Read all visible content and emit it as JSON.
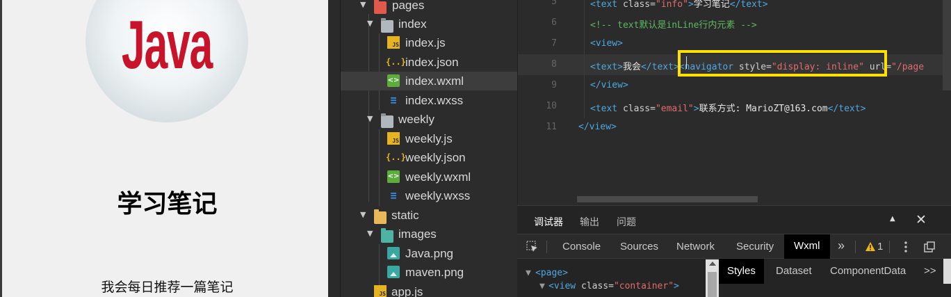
{
  "simulator": {
    "logo_text": "Java",
    "title": "学习笔记",
    "intro": "我会每日推荐一篇笔记"
  },
  "file_tree": {
    "items": [
      {
        "label": "pages",
        "kind": "folder-pages"
      },
      {
        "label": "index",
        "kind": "folder"
      },
      {
        "label": "index.js",
        "kind": "js"
      },
      {
        "label": "index.json",
        "kind": "json"
      },
      {
        "label": "index.wxml",
        "kind": "wxml",
        "selected": true
      },
      {
        "label": "index.wxss",
        "kind": "wxss"
      },
      {
        "label": "weekly",
        "kind": "folder"
      },
      {
        "label": "weekly.js",
        "kind": "js"
      },
      {
        "label": "weekly.json",
        "kind": "json"
      },
      {
        "label": "weekly.wxml",
        "kind": "wxml"
      },
      {
        "label": "weekly.wxss",
        "kind": "wxss"
      },
      {
        "label": "static",
        "kind": "folder-static"
      },
      {
        "label": "images",
        "kind": "folder-images"
      },
      {
        "label": "Java.png",
        "kind": "png"
      },
      {
        "label": "maven.png",
        "kind": "png"
      },
      {
        "label": "app.js",
        "kind": "js"
      }
    ]
  },
  "editor": {
    "line_numbers": [
      "5",
      "6",
      "7",
      "8",
      "9",
      "10",
      "11"
    ],
    "line5": {
      "open": "<text ",
      "attr": "class=",
      "value": "\"info\"",
      "close": ">",
      "text": "学习笔记",
      "end": "</text>"
    },
    "line6": "<!-- text默认是inLine行内元素 -->",
    "line7": "<view>",
    "line8": {
      "open": "<text>",
      "text": "我会",
      "close": "</text>",
      "nav": "<navigator",
      "attr": " style=",
      "value": "\"display: inline\"",
      "attr2": " url=",
      "value2": "\"/page"
    },
    "line9": "</view>",
    "line10": {
      "open": "<text ",
      "attr": "class=",
      "value": "\"email\"",
      "close": ">",
      "text": "联系方式: MarioZT@163.com",
      "end": "</text>"
    },
    "line11": "</view>"
  },
  "debugger": {
    "tabs": [
      "调试器",
      "输出",
      "问题"
    ],
    "devtools_tabs": [
      "Console",
      "Sources",
      "Network",
      "Security",
      "Wxml"
    ],
    "more": "»",
    "warning_count": "1",
    "elements": {
      "line1": "<page>",
      "line2_tag": "<view",
      "line2_attr": " class=",
      "line2_value": "\"container\"",
      "line2_end": ">"
    },
    "side_tabs": [
      "Styles",
      "Dataset",
      "ComponentData",
      ">>"
    ]
  }
}
